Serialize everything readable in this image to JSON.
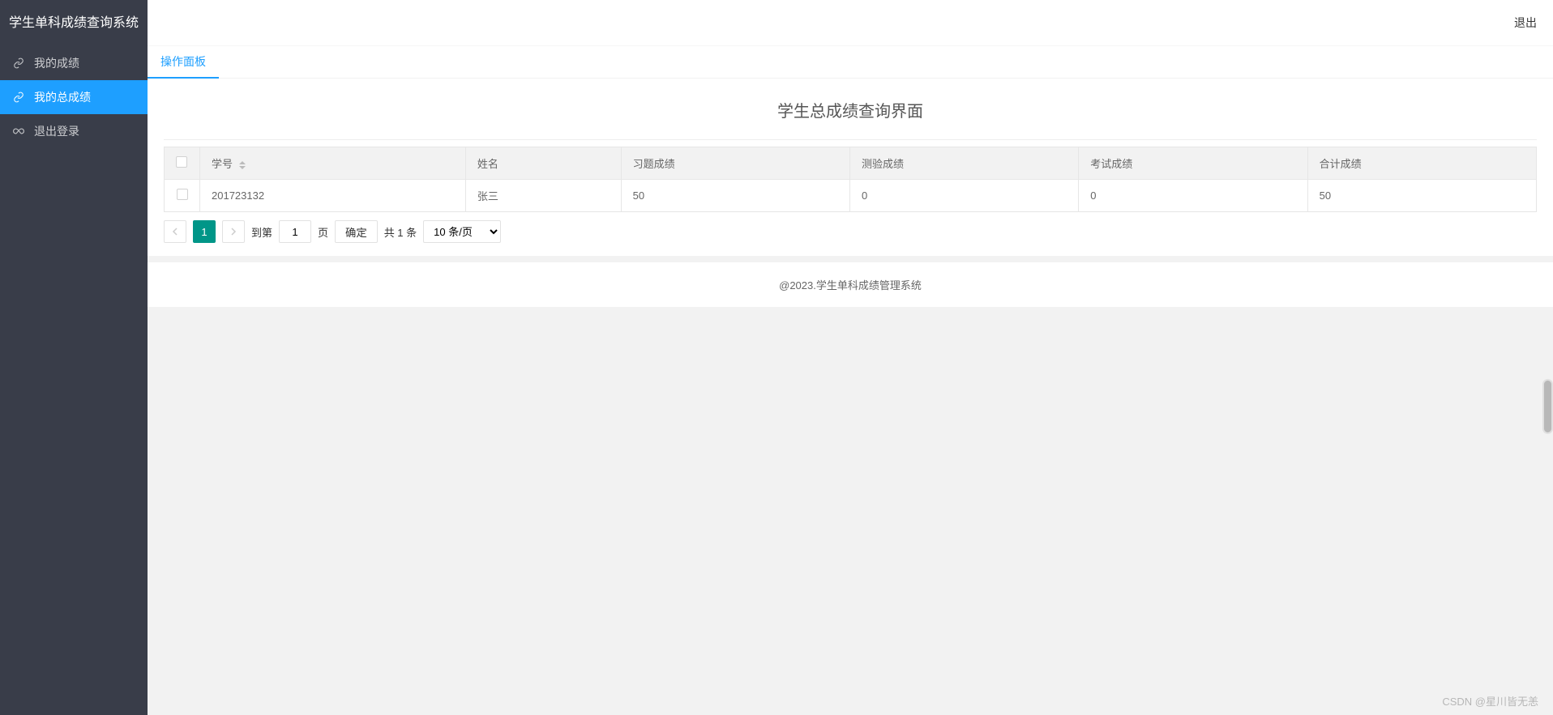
{
  "app_title": "学生单科成绩查询系统",
  "header": {
    "logout_label": "退出"
  },
  "sidebar": {
    "items": [
      {
        "label": "我的成绩",
        "icon": "link-icon"
      },
      {
        "label": "我的总成绩",
        "icon": "link-icon",
        "active": true
      },
      {
        "label": "退出登录",
        "icon": "infinity-icon"
      }
    ]
  },
  "tabs": [
    {
      "label": "操作面板",
      "active": true
    }
  ],
  "page_heading": "学生总成绩查询界面",
  "table": {
    "columns": [
      "学号",
      "姓名",
      "习题成绩",
      "测验成绩",
      "考试成绩",
      "合计成绩"
    ],
    "rows": [
      {
        "id": "201723132",
        "name": "张三",
        "hw": "50",
        "quiz": "0",
        "exam": "0",
        "total": "50"
      }
    ]
  },
  "pagination": {
    "prev": "<",
    "next": ">",
    "current_page": "1",
    "goto_prefix": "到第",
    "goto_input": "1",
    "goto_suffix": "页",
    "confirm": "确定",
    "total_text": "共 1 条",
    "per_page": "10 条/页"
  },
  "footer": "@2023.学生单科成绩管理系统",
  "watermark": "CSDN @星川皆无恙"
}
